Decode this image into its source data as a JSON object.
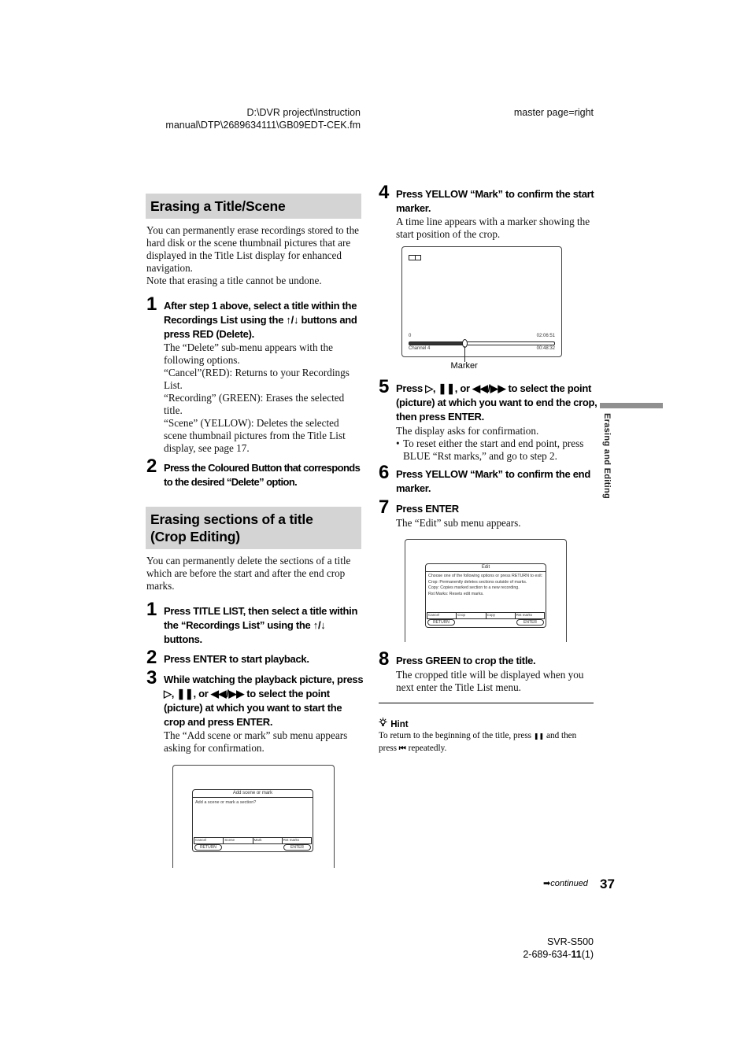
{
  "header": {
    "file_path_line1": "D:\\DVR project\\Instruction",
    "file_path_line2": "manual\\DTP\\2689634111\\GB09EDT-CEK.fm",
    "master_page": "master page=right"
  },
  "section1": {
    "title": "Erasing a Title/Scene",
    "intro": "You can permanently erase recordings stored to the hard disk or the scene thumbnail pictures that are displayed in the Title List display for enhanced navigation.",
    "note": "Note that erasing a title cannot be undone.",
    "steps": [
      {
        "num": "1",
        "heading": "After step 1 above, select a title within the Recordings List using the ↑/↓ buttons and press RED (Delete).",
        "body": [
          "The “Delete” sub-menu appears with the following options.",
          "“Cancel”(RED): Returns to your Recordings List.",
          "“Recording” (GREEN): Erases the selected title.",
          "“Scene” (YELLOW): Deletes the selected scene thumbnail pictures from the Title List display, see page 17."
        ]
      },
      {
        "num": "2",
        "heading": "Press the Coloured Button that corresponds to the desired “Delete” option."
      }
    ]
  },
  "section2": {
    "title_line1": "Erasing sections of a title",
    "title_line2": "(Crop Editing)",
    "intro": "You can permanently delete the sections of a title which are before the start and after the end crop marks.",
    "steps": [
      {
        "num": "1",
        "heading": "Press TITLE LIST, then select a title within the “Recordings List” using the ↑/↓ buttons."
      },
      {
        "num": "2",
        "heading": "Press ENTER to start playback."
      },
      {
        "num": "3",
        "heading": "While watching the playback picture, press ▷, ❚❚, or ◀◀/▶▶ to select the point (picture) at which you want to start the crop and press ENTER.",
        "body": "The “Add scene or mark” sub menu appears asking for confirmation."
      },
      {
        "num": "4",
        "heading": "Press YELLOW “Mark” to confirm the start marker.",
        "body": "A time line appears with a marker showing the start position of the crop."
      },
      {
        "num": "5",
        "heading": "Press ▷, ❚❚, or ◀◀/▶▶ to select the point (picture) at which you want to end the crop, then press ENTER.",
        "body": "The display asks for confirmation.",
        "bullet": "To reset either the start and end point, press BLUE  “Rst marks,” and go to step 2."
      },
      {
        "num": "6",
        "heading": "Press YELLOW “Mark” to confirm the end marker."
      },
      {
        "num": "7",
        "heading": "Press ENTER",
        "body": "The “Edit” sub menu appears."
      },
      {
        "num": "8",
        "heading": "Press GREEN to crop the title.",
        "body": "The cropped title will be displayed when you next enter the Title List menu."
      }
    ]
  },
  "screen_add_mark": {
    "title": "Add scene or mark",
    "message": "Add a scene or mark a section?",
    "color_buttons": [
      "Cancel",
      "Scene",
      "Mark",
      "Rst marks"
    ],
    "return_label": "RETURN",
    "enter_label": "ENTER"
  },
  "screen_timeline": {
    "start_time": "0",
    "total_time": "02:06:51",
    "channel": "Channel 4",
    "current_time": "00:48:32",
    "marker_position_fraction": 0.38,
    "marker_label": "Marker"
  },
  "screen_edit": {
    "title": "Edit",
    "lines": [
      "Choose one of the following options or press RETURN to exit:",
      "Crop: Permanently deletes sections outside of marks.",
      "Copy: Copies marked section to a new recording.",
      "Rst Marks: Resets edit marks."
    ],
    "color_buttons": [
      "Cancel",
      "Crop",
      "Copy",
      "Rst marks"
    ],
    "return_label": "RETURN",
    "enter_label": "ENTER"
  },
  "side_tab": {
    "label": "Erasing and Editing"
  },
  "hint": {
    "heading": "Hint",
    "text_before": "To return to the beginning of the title, press ",
    "pause_glyph": "❚❚",
    "text_middle": " and then press ",
    "prev_glyph": "⏮",
    "text_after": "  repeatedly."
  },
  "footer": {
    "continued": "continued",
    "page_number": "37",
    "model": "SVR-S500",
    "doc_code_prefix": "2-689-634-",
    "doc_code_bold": "11",
    "doc_code_suffix": "(1)"
  }
}
